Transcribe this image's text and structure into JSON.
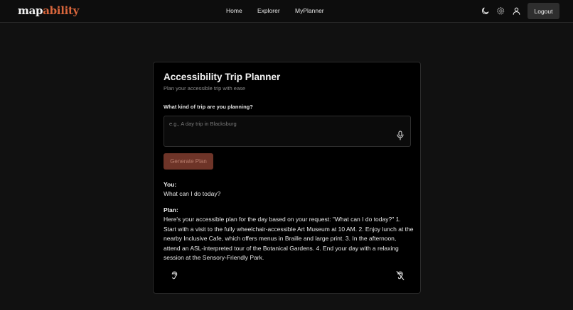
{
  "brand": {
    "logo_part1": "map",
    "logo_part2": "ability",
    "accent_color": "#d9663c"
  },
  "nav": {
    "links": [
      "Home",
      "Explorer",
      "MyPlanner"
    ],
    "icons": [
      "moon-icon",
      "gear-icon",
      "user-icon"
    ],
    "logout_label": "Logout"
  },
  "planner": {
    "title": "Accessibility Trip Planner",
    "subtitle": "Plan your accessible trip with ease",
    "question": "What kind of trip are you planning?",
    "input_value": "",
    "input_placeholder": "e.g., A day trip in Blacksburg",
    "generate_label": "Generate Plan",
    "button_color": "#6e3428"
  },
  "conversation": {
    "you_label": "You:",
    "you_text": "What can I do today?",
    "plan_label": "Plan:",
    "plan_text": "Here's your accessible plan for the day based on your request: \"What can I do today?\" 1. Start with a visit to the fully wheelchair-accessible Art Museum at 10 AM. 2. Enjoy lunch at the nearby Inclusive Cafe, which offers menus in Braille and large print. 3. In the afternoon, attend an ASL-interpreted tour of the Botanical Gardens. 4. End your day with a relaxing session at the Sensory-Friendly Park."
  },
  "actions": {
    "icons": [
      "ear-icon",
      "ear-off-icon"
    ]
  }
}
